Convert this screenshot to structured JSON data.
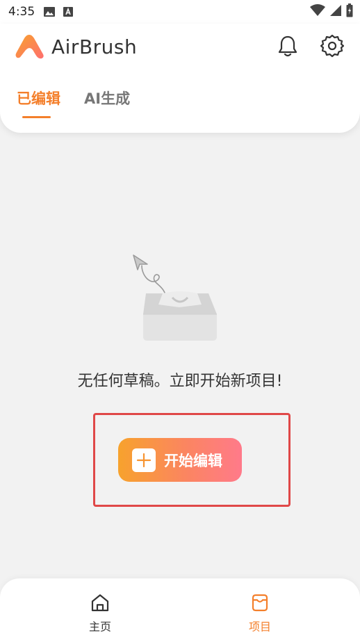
{
  "status_bar": {
    "time": "4:35",
    "icons_left": [
      "image-icon",
      "a-notification-icon"
    ],
    "icons_right": [
      "wifi-icon",
      "signal-icon",
      "battery-charging-icon"
    ]
  },
  "header": {
    "app_title": "AirBrush",
    "bell_icon": "bell-icon",
    "settings_icon": "gear-icon"
  },
  "tabs": [
    {
      "label": "已编辑",
      "active": true
    },
    {
      "label": "AI生成",
      "active": false
    }
  ],
  "empty_state": {
    "message": "无任何草稿。立即开始新项目!",
    "button_label": "开始编辑"
  },
  "bottom_nav": [
    {
      "label": "主页",
      "icon": "home-icon",
      "active": false
    },
    {
      "label": "项目",
      "icon": "projects-box-icon",
      "active": true
    }
  ],
  "colors": {
    "accent": "#f47f2b",
    "highlight_border": "#e04848",
    "button_gradient_start": "#f7a22d",
    "button_gradient_end": "#ff7a8a"
  }
}
